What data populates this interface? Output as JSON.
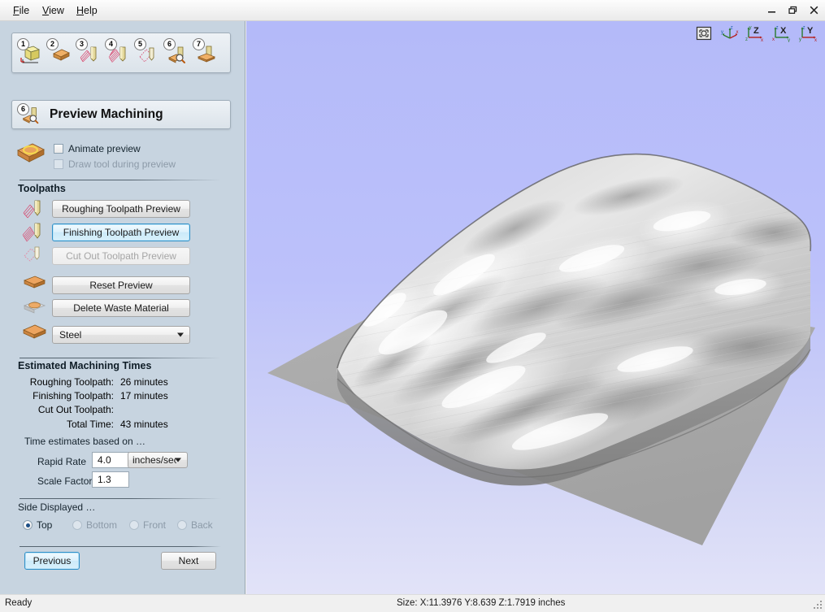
{
  "window": {
    "menu": [
      {
        "label": "File",
        "accel": "F"
      },
      {
        "label": "View",
        "accel": "V"
      },
      {
        "label": "Help",
        "accel": "H"
      }
    ],
    "controls": [
      {
        "name": "minimize",
        "glyph": "–"
      },
      {
        "name": "restore",
        "glyph": "❐"
      },
      {
        "name": "close",
        "glyph": "✕"
      }
    ]
  },
  "steps": [
    {
      "num": "1",
      "icon": "model-cube-icon",
      "title": "Model"
    },
    {
      "num": "2",
      "icon": "material-block-icon",
      "title": "Material"
    },
    {
      "num": "3",
      "icon": "roughing-toolpath-icon",
      "title": "Roughing Toolpath"
    },
    {
      "num": "4",
      "icon": "finishing-toolpath-icon",
      "title": "Finishing Toolpath"
    },
    {
      "num": "5",
      "icon": "cutout-toolpath-icon",
      "title": "Cut Out Toolpath"
    },
    {
      "num": "6",
      "icon": "preview-machining-icon",
      "title": "Preview Machining"
    },
    {
      "num": "7",
      "icon": "save-toolpath-icon",
      "title": "Save Toolpath"
    }
  ],
  "header": {
    "num": "6",
    "title": "Preview Machining"
  },
  "options": {
    "animate_preview": {
      "label": "Animate preview",
      "checked": false,
      "enabled": true
    },
    "draw_tool": {
      "label": "Draw tool during preview",
      "checked": false,
      "enabled": false
    }
  },
  "toolpaths": {
    "group_title": "Toolpaths",
    "buttons": [
      {
        "label": "Roughing Toolpath Preview",
        "state": "normal",
        "icon": "roughing-toolpath-icon"
      },
      {
        "label": "Finishing Toolpath Preview",
        "state": "focused",
        "icon": "finishing-toolpath-icon"
      },
      {
        "label": "Cut Out Toolpath Preview",
        "state": "disabled",
        "icon": "cutout-toolpath-icon"
      },
      {
        "label": "Reset Preview",
        "state": "normal",
        "icon": "material-block-icon"
      },
      {
        "label": "Delete Waste Material",
        "state": "normal",
        "icon": "waste-material-icon"
      }
    ],
    "material_select": {
      "value": "Steel",
      "icon": "material-block-icon"
    }
  },
  "times": {
    "group_title": "Estimated Machining Times",
    "rows": [
      {
        "label": "Roughing Toolpath:",
        "value": "26 minutes"
      },
      {
        "label": "Finishing Toolpath:",
        "value": "17 minutes"
      },
      {
        "label": "Cut Out Toolpath:",
        "value": ""
      },
      {
        "label": "Total Time:",
        "value": "43 minutes"
      }
    ],
    "note": "Time estimates based on …",
    "rapid_rate": {
      "label": "Rapid Rate",
      "value": "4.0",
      "units": "inches/sec"
    },
    "scale_factor": {
      "label": "Scale Factor",
      "value": "1.3"
    }
  },
  "side_displayed": {
    "group_title": "Side Displayed …",
    "options": [
      {
        "label": "Top",
        "checked": true,
        "enabled": true
      },
      {
        "label": "Bottom",
        "checked": false,
        "enabled": false
      },
      {
        "label": "Front",
        "checked": false,
        "enabled": false
      },
      {
        "label": "Back",
        "checked": false,
        "enabled": false
      }
    ]
  },
  "nav": {
    "previous_label": "Previous",
    "next_label": "Next"
  },
  "viewport": {
    "icons": [
      {
        "name": "fit-to-window-icon"
      },
      {
        "name": "isometric-view-icon"
      },
      {
        "name": "z-axis-view-icon",
        "letter": "Z"
      },
      {
        "name": "x-axis-view-icon",
        "letter": "X"
      },
      {
        "name": "y-axis-view-icon",
        "letter": "Y"
      }
    ],
    "background_top": "#b4baf9",
    "background_bottom": "#e2e3f8",
    "base_color": "#a8a8a8"
  },
  "statusbar": {
    "ready_text": "Ready",
    "size_text": "Size: X:11.3976 Y:8.639 Z:1.7919 inches"
  }
}
